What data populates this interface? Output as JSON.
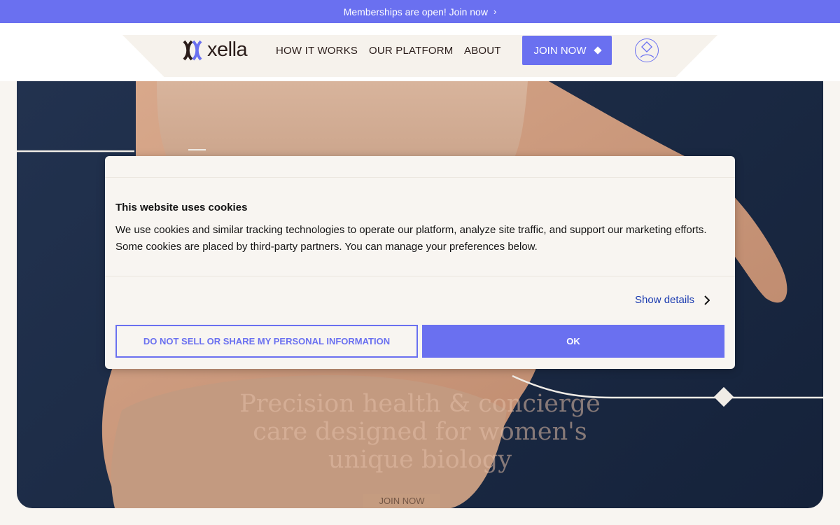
{
  "announcement": {
    "text": "Memberships are open! Join now",
    "chevron": "›"
  },
  "header": {
    "logo_text": "xella",
    "nav": [
      {
        "label": "HOW IT WORKS"
      },
      {
        "label": "OUR PLATFORM"
      },
      {
        "label": "ABOUT"
      }
    ],
    "join_label": "JOIN NOW"
  },
  "hero": {
    "headline_lines": [
      "Precision health & concierge",
      "care designed for women's",
      "unique biology"
    ],
    "cta_label": "JOIN NOW"
  },
  "cookie": {
    "title": "This website uses cookies",
    "body": "We use cookies and similar tracking technologies to operate our platform, analyze site traffic, and support our marketing efforts. Some cookies are placed by third-party partners. You can manage your preferences below.",
    "show_details": "Show details",
    "do_not_sell": "DO NOT SELL OR SHARE MY PERSONAL INFORMATION",
    "ok": "OK"
  },
  "colors": {
    "accent": "#6a70f0",
    "link": "#1b3bb0",
    "hero_bg": "#1b2a44",
    "page_bg": "#f8f5f1"
  }
}
